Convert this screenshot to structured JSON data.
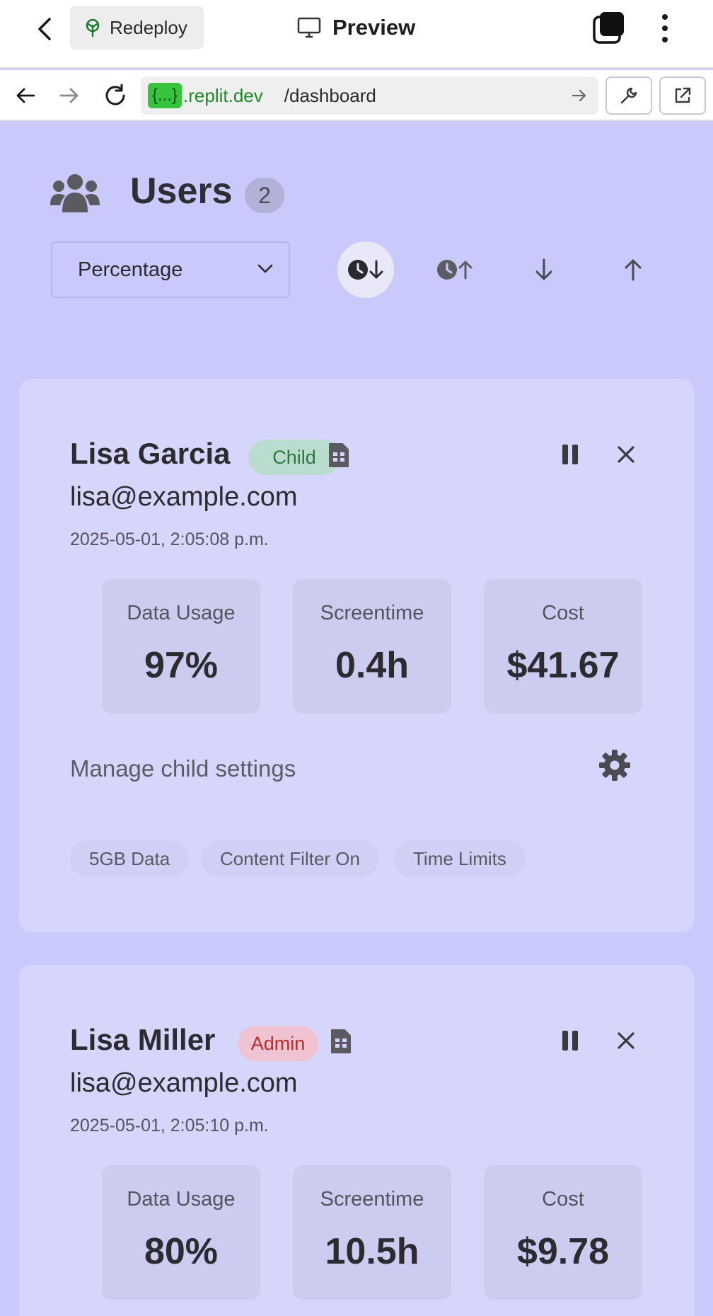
{
  "topbar": {
    "redeploy_label": "Redeploy",
    "preview_label": "Preview"
  },
  "browser": {
    "url_chip": "{...}",
    "url_domain": ".replit.dev",
    "url_path": "/dashboard"
  },
  "users": {
    "title": "Users",
    "count": "2",
    "sort_select": {
      "value": "Percentage"
    }
  },
  "cards": [
    {
      "name": "Lisa Garcia",
      "role": "Child",
      "email": "lisa@example.com",
      "date": "2025-05-01, 2:05:08 p.m.",
      "stats": [
        {
          "label": "Data Usage",
          "value": "97%"
        },
        {
          "label": "Screentime",
          "value": "0.4h"
        },
        {
          "label": "Cost",
          "value": "$41.67"
        }
      ],
      "manage_label": "Manage child settings",
      "tags": [
        "5GB Data",
        "Content Filter On",
        "Time Limits"
      ]
    },
    {
      "name": "Lisa Miller",
      "role": "Admin",
      "email": "lisa@example.com",
      "date": "2025-05-01, 2:05:10 p.m.",
      "stats": [
        {
          "label": "Data Usage",
          "value": "80%"
        },
        {
          "label": "Screentime",
          "value": "10.5h"
        },
        {
          "label": "Cost",
          "value": "$9.78"
        }
      ]
    }
  ],
  "colors": {
    "page_bg": "#c9c9fb",
    "card_bg": "#d6d6fc",
    "child_badge": "#b9dccf",
    "admin_badge": "#efc3d1",
    "url_chip": "#35c43b"
  }
}
